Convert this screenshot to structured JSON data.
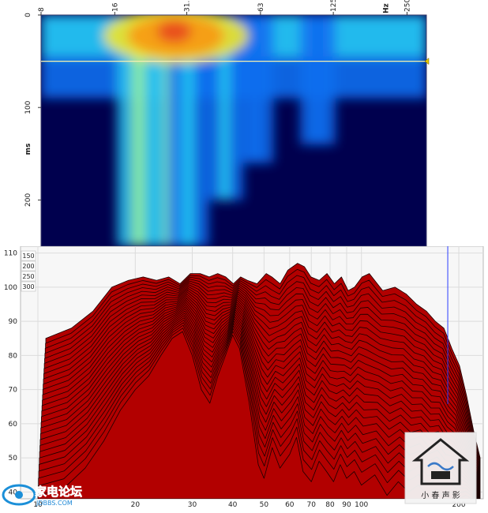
{
  "spectrogram": {
    "x_unit": "Hz",
    "x_ticks": [
      "8",
      "16",
      "31.5",
      "63",
      "125",
      "250"
    ],
    "y_unit": "ms",
    "y_ticks": [
      "0",
      "100",
      "200"
    ],
    "colormap": [
      "#00004e",
      "#0a1cd2",
      "#0f6ef0",
      "#23c3f0",
      "#8ff0a0",
      "#f0e628",
      "#f79c14",
      "#e8461e"
    ]
  },
  "chart_data": [
    {
      "type": "heatmap",
      "title": "",
      "xlabel": "Hz",
      "ylabel": "ms",
      "x_scale": "log",
      "xlim": [
        8,
        300
      ],
      "ylim": [
        0,
        250
      ],
      "x_ticks": [
        8,
        16,
        31.5,
        63,
        125,
        250
      ],
      "y_ticks": [
        0,
        100,
        200
      ],
      "marker_ms": 50,
      "energy_ridges": [
        {
          "hz": 20,
          "decay_ms": 250,
          "level": 0.7
        },
        {
          "hz": 27,
          "decay_ms": 250,
          "level": 0.78
        },
        {
          "hz": 32,
          "decay_ms": 250,
          "level": 0.62
        },
        {
          "hz": 45,
          "decay_ms": 200,
          "level": 0.48
        },
        {
          "hz": 60,
          "decay_ms": 160,
          "level": 0.45
        },
        {
          "hz": 108,
          "decay_ms": 140,
          "level": 0.4
        }
      ],
      "hot_region": {
        "hz_from": 18,
        "hz_to": 45,
        "ms_from": 0,
        "ms_to": 45,
        "level": 0.95
      }
    },
    {
      "type": "area",
      "title": "",
      "xlabel": "",
      "ylabel": "",
      "x_scale": "log",
      "xlim": [
        10,
        220
      ],
      "ylim": [
        38,
        112
      ],
      "x_ticks": [
        10,
        20,
        30,
        40,
        50,
        60,
        70,
        80,
        90,
        100,
        200
      ],
      "y_ticks": [
        40,
        50,
        60,
        70,
        80,
        90,
        100,
        110
      ],
      "depth_labels": [
        "150",
        "200",
        "250",
        "300"
      ],
      "fill_color": "#b20000",
      "cursor_hz": 200,
      "series": [
        {
          "role": "front_slice",
          "x": [
            10,
            12,
            14,
            16,
            18,
            20,
            22,
            24,
            26,
            28,
            30,
            32,
            34,
            36,
            38,
            40,
            42,
            45,
            48,
            50,
            53,
            56,
            60,
            63,
            66,
            70,
            74,
            78,
            82,
            86,
            90,
            95,
            100,
            110,
            120,
            130,
            140,
            150,
            160,
            170,
            180,
            190,
            200,
            210,
            220
          ],
          "values": [
            39,
            41,
            47,
            55,
            64,
            70,
            74,
            80,
            85,
            87,
            80,
            70,
            66,
            74,
            80,
            86,
            82,
            66,
            48,
            44,
            53,
            47,
            51,
            56,
            46,
            43,
            49,
            46,
            43,
            48,
            44,
            46,
            42,
            45,
            39,
            43,
            40,
            42,
            39,
            41,
            39,
            40,
            38,
            39,
            38
          ]
        },
        {
          "role": "back_slice",
          "x": [
            10,
            12,
            14,
            16,
            18,
            20,
            22,
            24,
            26,
            28,
            30,
            32,
            34,
            36,
            38,
            40,
            42,
            45,
            48,
            50,
            53,
            56,
            60,
            63,
            66,
            70,
            74,
            78,
            82,
            86,
            90,
            95,
            100,
            110,
            120,
            130,
            140,
            150,
            160,
            170,
            180,
            190,
            200,
            210,
            220
          ],
          "values": [
            85,
            88,
            93,
            100,
            102,
            103,
            102,
            103,
            101,
            104,
            104,
            103,
            104,
            103,
            101,
            103,
            102,
            101,
            104,
            103,
            101,
            105,
            107,
            106,
            103,
            102,
            104,
            101,
            103,
            99,
            100,
            103,
            104,
            99,
            100,
            98,
            95,
            93,
            90,
            88,
            82,
            77,
            68,
            58,
            50
          ]
        }
      ],
      "slice_count": 28
    }
  ],
  "watermarks": {
    "left_text": "家电论坛",
    "left_sub": "JDBBS.COM",
    "right_text": "小 春 声 影"
  }
}
